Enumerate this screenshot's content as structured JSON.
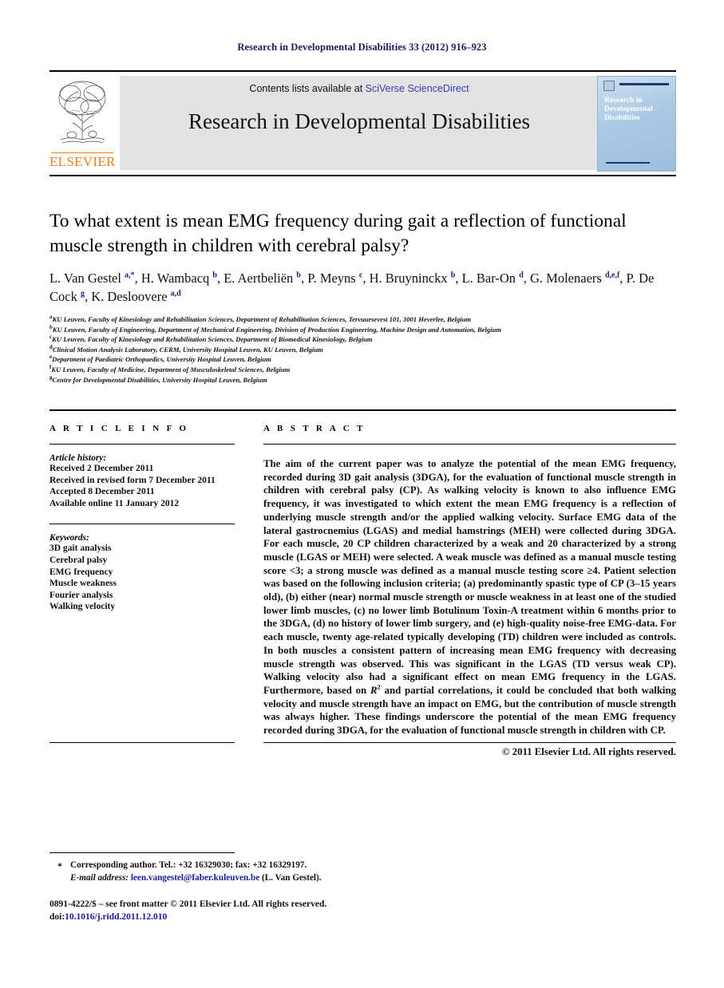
{
  "running_head": "Research in Developmental Disabilities 33 (2012) 916–923",
  "masthead": {
    "contents_prefix": "Contents lists available at ",
    "sciencedirect": "SciVerse ScienceDirect",
    "journal_name": "Research in Developmental Disabilities",
    "publisher_wordmark": "ELSEVIER",
    "cover_title": "Research in Developmental Disabilities",
    "link_color": "#3b3bb5",
    "publisher_color": "#f07d18"
  },
  "article": {
    "title": "To what extent is mean EMG frequency during gait a reflection of functional muscle strength in children with cerebral palsy?",
    "authors_html": "L. Van Gestel <sup>a,*</sup>, H. Wambacq <sup>b</sup>, E. Aertbeliën <sup>b</sup>, P. Meyns <sup>c</sup>, H. Bruyninckx <sup>b</sup>, L. Bar-On <sup>d</sup>, G. Molenaers <sup>d,e,f</sup>, P. De Cock <sup>g</sup>, K. Desloovere <sup>a,d</sup>",
    "affiliations": [
      {
        "marker": "a",
        "text": "KU Leuven, Faculty of Kinesiology and Rehabilitation Sciences, Department of Rehabilitation Sciences, Tervuursevest 101, 3001 Heverlee, Belgium"
      },
      {
        "marker": "b",
        "text": "KU Leuven, Faculty of Engineering, Department of Mechanical Engineering, Division of Production Engineering, Machine Design and Automation, Belgium"
      },
      {
        "marker": "c",
        "text": "KU Leuven, Faculty of Kinesiology and Rehabilitation Sciences, Department of Biomedical Kinesiology, Belgium"
      },
      {
        "marker": "d",
        "text": "Clinical Motion Analysis Laboratory, CERM, University Hospital Leuven, KU Leuven, Belgium"
      },
      {
        "marker": "e",
        "text": "Department of Paediatric Orthopaedics, University Hospital Leuven, Belgium"
      },
      {
        "marker": "f",
        "text": "KU Leuven, Faculty of Medicine, Department of Musculoskeletal Sciences, Belgium"
      },
      {
        "marker": "g",
        "text": "Centre for Developmental Disabilities, University Hospital Leuven, Belgium"
      }
    ]
  },
  "article_info": {
    "heading": "A R T I C L E   I N F O",
    "history_label": "Article history:",
    "history": [
      "Received 2 December 2011",
      "Received in revised form 7 December 2011",
      "Accepted 8 December 2011",
      "Available online 11 January 2012"
    ],
    "keywords_label": "Keywords:",
    "keywords": [
      "3D gait analysis",
      "Cerebral palsy",
      "EMG frequency",
      "Muscle weakness",
      "Fourier analysis",
      "Walking velocity"
    ]
  },
  "abstract": {
    "heading": "A B S T R A C T",
    "body_html": "The aim of the current paper was to analyze the potential of the mean EMG frequency, recorded during 3D gait analysis (3DGA), for the evaluation of functional muscle strength in children with cerebral palsy (CP). As walking velocity is known to also influence EMG frequency, it was investigated to which extent the mean EMG frequency is a reflection of underlying muscle strength and/or the applied walking velocity. Surface EMG data of the lateral gastrocnemius (LGAS) and medial hamstrings (MEH) were collected during 3DGA. For each muscle, 20 CP children characterized by a weak and 20 characterized by a strong muscle (LGAS or MEH) were selected. A weak muscle was defined as a manual muscle testing score &lt;3; a strong muscle was defined as a manual muscle testing score &ge;4. Patient selection was based on the following inclusion criteria; (a) predominantly spastic type of CP (3–15 years old), (b) either (near) normal muscle strength or muscle weakness in at least one of the studied lower limb muscles, (c) no lower limb Botulinum Toxin-A treatment within 6 months prior to the 3DGA, (d) no history of lower limb surgery, and (e) high-quality noise-free EMG-data. For each muscle, twenty age-related typically developing (TD) children were included as controls. In both muscles a consistent pattern of increasing mean EMG frequency with decreasing muscle strength was observed. This was significant in the LGAS (TD versus weak CP). Walking velocity also had a significant effect on mean EMG frequency in the LGAS. Furthermore, based on <i>R</i><sup>2</sup> and partial correlations, it could be concluded that both walking velocity and muscle strength have an impact on EMG, but the contribution of muscle strength was always higher. These findings underscore the potential of the mean EMG frequency recorded during 3DGA, for the evaluation of functional muscle strength in children with CP.",
    "copyright": "© 2011 Elsevier Ltd. All rights reserved."
  },
  "footer": {
    "corresponding_author": "Corresponding author. Tel.: +32 16329030; fax: +32 16329197.",
    "email_label": "E-mail address:",
    "email": "leen.vangestel@faber.kuleuven.be",
    "email_suffix": "(L. Van Gestel).",
    "issn_line": "0891-4222/$ – see front matter © 2011 Elsevier Ltd. All rights reserved.",
    "doi_label": "doi:",
    "doi": "10.1016/j.ridd.2011.12.010"
  }
}
